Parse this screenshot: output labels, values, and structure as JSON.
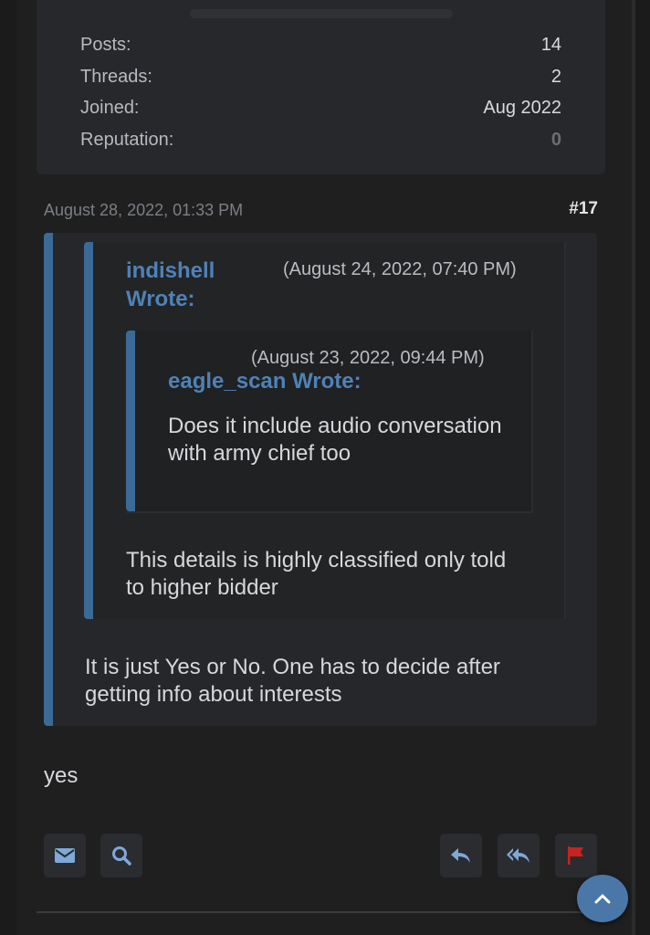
{
  "user_stats": [
    {
      "label": "Posts:",
      "value": "14"
    },
    {
      "label": "Threads:",
      "value": "2"
    },
    {
      "label": "Joined:",
      "value": "Aug 2022"
    },
    {
      "label": "Reputation:",
      "value": "0"
    }
  ],
  "post": {
    "date": "August 28, 2022, 01:33 PM",
    "number": "#17",
    "quote_outer": {
      "text": "It is just Yes or No. One has to decide after getting info about interests"
    },
    "quote_mid": {
      "author_line1": "indishell",
      "author_line2": "Wrote:",
      "date": "(August 24, 2022, 07:40 PM)",
      "text": "This details is highly classified only told to higher bidder"
    },
    "quote_inner": {
      "date": "(August 23, 2022, 09:44 PM)",
      "author": "eagle_scan Wrote:",
      "text": "Does it include audio conversation with army chief too"
    },
    "reply": "yes"
  },
  "actions": {
    "left": [
      "envelope-icon",
      "search-icon"
    ],
    "right": [
      "reply-icon",
      "reply-all-icon",
      "flag-icon"
    ]
  },
  "colors": {
    "accent": "#3c6a96",
    "link": "#4f82b6",
    "flag": "#c8231f"
  }
}
